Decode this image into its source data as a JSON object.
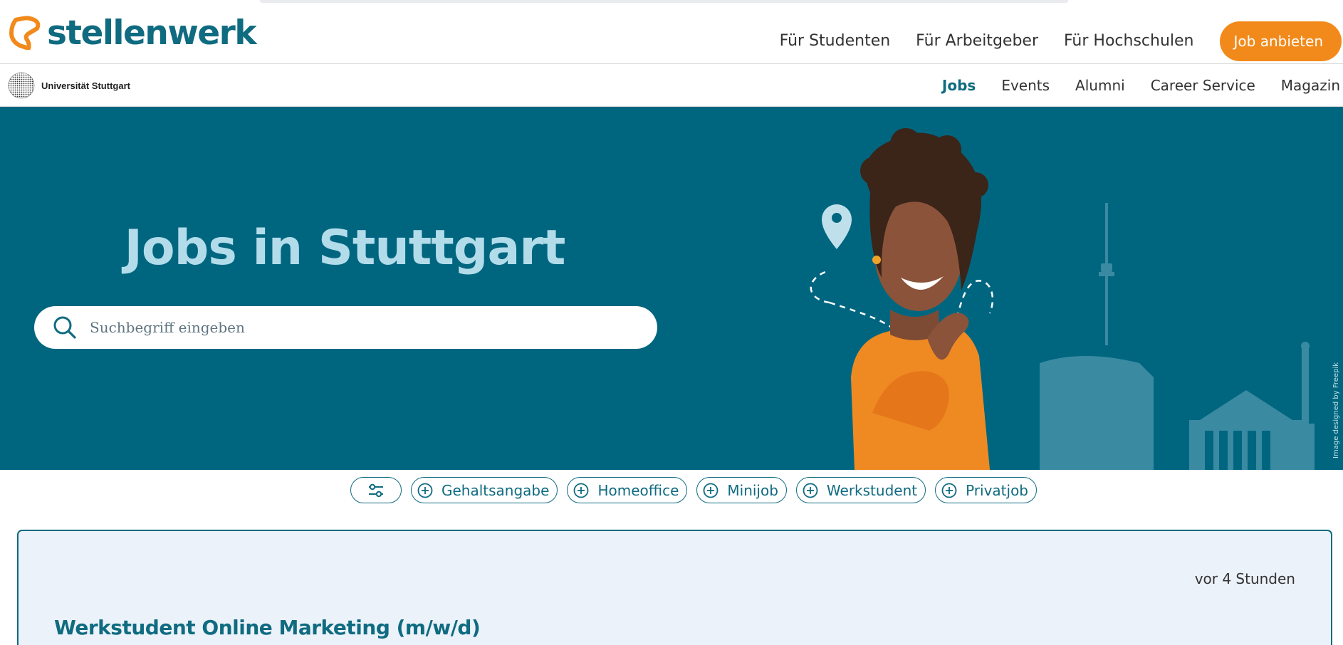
{
  "brand": {
    "name": "stellenwerk",
    "accent": "#0f6b80",
    "orange": "#f28a1b",
    "hero_bg": "#006680"
  },
  "top_nav": {
    "items": [
      "Für Studenten",
      "Für Arbeitgeber",
      "Für Hochschulen"
    ],
    "cta_label": "Job anbieten"
  },
  "university": {
    "name": "Universität Stuttgart"
  },
  "sub_nav": {
    "items": [
      "Jobs",
      "Events",
      "Alumni",
      "Career Service",
      "Magazin"
    ],
    "active": "Jobs"
  },
  "hero": {
    "title": "Jobs in Stuttgart",
    "search_placeholder": "Suchbegriff eingeben",
    "credit": "Image designed by Freepik"
  },
  "filters": {
    "settings_icon": "sliders-icon",
    "chips": [
      "Gehaltsangabe",
      "Homeoffice",
      "Minijob",
      "Werkstudent",
      "Privatjob"
    ]
  },
  "job_card": {
    "posted": "vor 4 Stunden",
    "title": "Werkstudent Online Marketing (m/w/d)"
  }
}
